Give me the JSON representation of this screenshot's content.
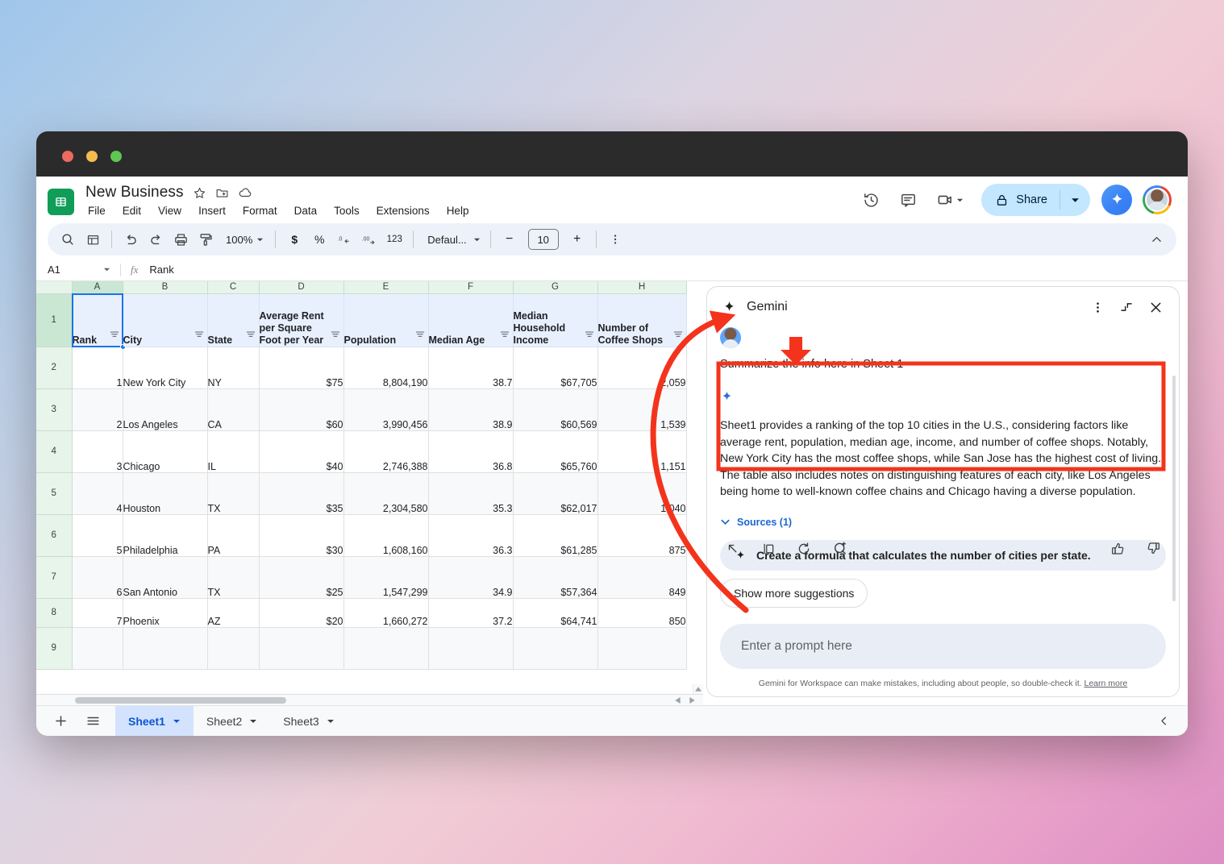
{
  "app": {
    "doc_title": "New Business",
    "menus": [
      "File",
      "Edit",
      "View",
      "Insert",
      "Format",
      "Data",
      "Tools",
      "Extensions",
      "Help"
    ]
  },
  "header_actions": {
    "history_icon": "version-history-icon",
    "comment_icon": "comment-icon",
    "meet_icon": "meet-camera-icon",
    "share_label": "Share",
    "lock_icon": "lock-icon",
    "gemini_icon": "gemini-spark-icon",
    "avatar": "user-avatar"
  },
  "toolbar": {
    "search_icon": "search-icon",
    "menus_icon": "all-sheets-icon",
    "undo_icon": "undo-icon",
    "redo_icon": "redo-icon",
    "print_icon": "print-icon",
    "paint_icon": "paint-format-icon",
    "zoom_value": "100%",
    "currency_icon": "$",
    "percent_icon": "%",
    "decrease_decimal": ".0",
    "increase_decimal": ".00",
    "more_formats": "123",
    "font_value": "Defaul...",
    "font_size_value": "10",
    "minus": "−",
    "plus": "+",
    "more_icon": "more-vertical-icon",
    "collapse_icon": "chevron-up-icon"
  },
  "formula_bar": {
    "name_box": "A1",
    "fx_label": "fx",
    "value": "Rank"
  },
  "grid": {
    "column_letters": [
      "A",
      "B",
      "C",
      "D",
      "E",
      "F",
      "G",
      "H"
    ],
    "row_numbers": [
      "1",
      "2",
      "3",
      "4",
      "5",
      "6",
      "7",
      "8",
      "9"
    ],
    "headers": [
      "Rank",
      "City",
      "State",
      "Average Rent per Square Foot per Year",
      "Population",
      "Median Age",
      "Median Household Income",
      "Number of Coffee Shops"
    ],
    "filter_icon": "filter-icon",
    "rows": [
      {
        "rank": "1",
        "city": "New York City",
        "state": "NY",
        "rent": "$75",
        "population": "8,804,190",
        "median_age": "38.7",
        "income": "$67,705",
        "coffee": "2,059"
      },
      {
        "rank": "2",
        "city": "Los Angeles",
        "state": "CA",
        "rent": "$60",
        "population": "3,990,456",
        "median_age": "38.9",
        "income": "$60,569",
        "coffee": "1,539"
      },
      {
        "rank": "3",
        "city": "Chicago",
        "state": "IL",
        "rent": "$40",
        "population": "2,746,388",
        "median_age": "36.8",
        "income": "$65,760",
        "coffee": "1,151"
      },
      {
        "rank": "4",
        "city": "Houston",
        "state": "TX",
        "rent": "$35",
        "population": "2,304,580",
        "median_age": "35.3",
        "income": "$62,017",
        "coffee": "1,040"
      },
      {
        "rank": "5",
        "city": "Philadelphia",
        "state": "PA",
        "rent": "$30",
        "population": "1,608,160",
        "median_age": "36.3",
        "income": "$61,285",
        "coffee": "875"
      },
      {
        "rank": "6",
        "city": "San Antonio",
        "state": "TX",
        "rent": "$25",
        "population": "1,547,299",
        "median_age": "34.9",
        "income": "$57,364",
        "coffee": "849"
      },
      {
        "rank": "7",
        "city": "Phoenix",
        "state": "AZ",
        "rent": "$20",
        "population": "1,660,272",
        "median_age": "37.2",
        "income": "$64,741",
        "coffee": "850"
      }
    ]
  },
  "gemini": {
    "title": "Gemini",
    "spark_icon": "gemini-spark-icon",
    "more_icon": "more-vertical-icon",
    "collapse_icon": "collapse-panel-icon",
    "close_icon": "close-icon",
    "user_prompt": "Summarize the info here in Sheet 1",
    "response": "Sheet1 provides a ranking of the top 10 cities in the U.S., considering factors like average rent, population, median age, income, and number of coffee shops. Notably, New York City has the most coffee shops, while San Jose has the highest cost of living. The table also includes notes on distinguishing features of each city, like Los Angeles being home to well-known coffee chains and Chicago having a diverse population.",
    "sources_label": "Sources (1)",
    "sources_chevron": "chevron-down-icon",
    "actions": [
      "insert-into-sheet-icon",
      "copy-icon",
      "refresh-icon",
      "refine-icon"
    ],
    "thumbs_up_icon": "thumbs-up-icon",
    "thumbs_down_icon": "thumbs-down-icon",
    "suggestion": "Create a formula that calculates the number of cities per state.",
    "show_more_label": "Show more suggestions",
    "prompt_placeholder": "Enter a prompt here",
    "disclaimer": "Gemini for Workspace can make mistakes, including about people, so double-check it.",
    "disclaimer_link": "Learn more"
  },
  "sheet_tabs": {
    "add_icon": "add-sheet-icon",
    "list_icon": "all-sheets-list-icon",
    "tabs": [
      {
        "label": "Sheet1",
        "active": true
      },
      {
        "label": "Sheet2",
        "active": false
      },
      {
        "label": "Sheet3",
        "active": false
      }
    ],
    "collapse_icon": "chevron-left-icon"
  },
  "annotation": {
    "color": "#F4331C",
    "highlight_box": "response-highlight",
    "arrow_down": "arrow-pointing-to-response",
    "arrow_curved": "arrow-from-prompt-to-question"
  }
}
